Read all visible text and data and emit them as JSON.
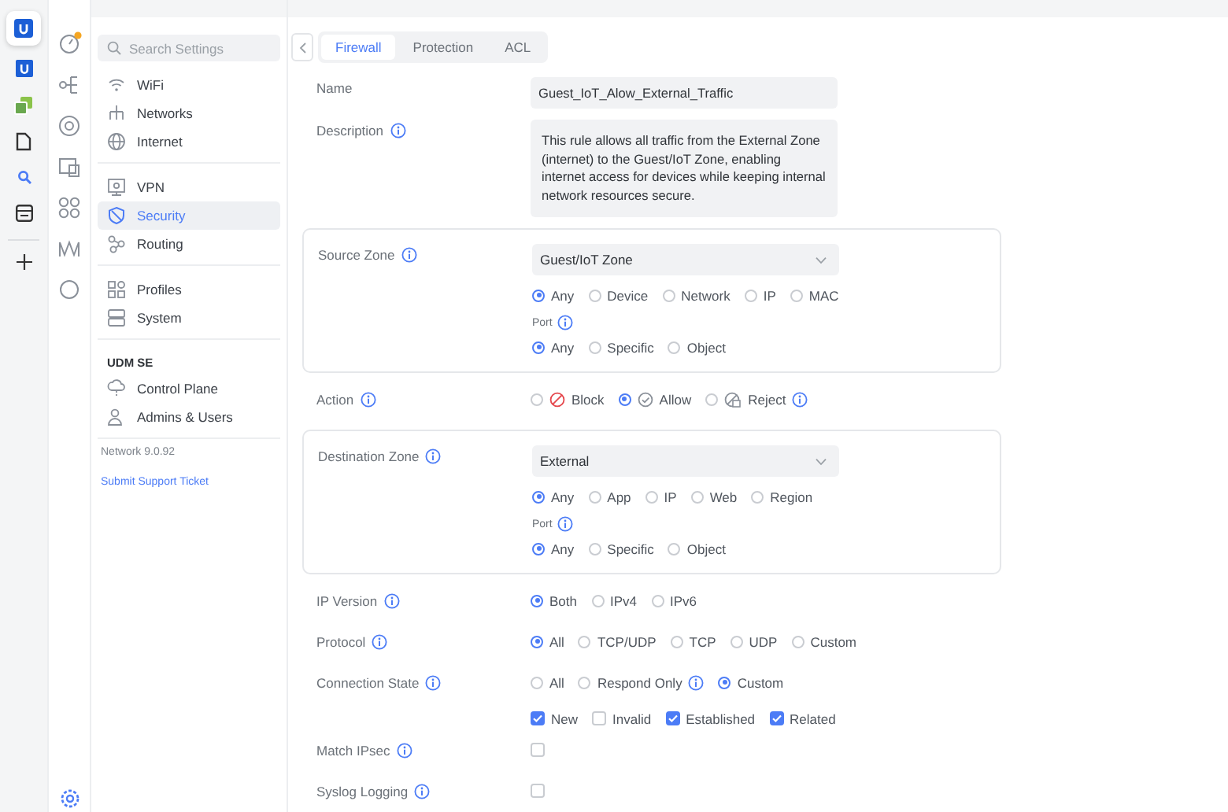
{
  "app_rail": {
    "items": [
      {
        "kind": "unifi",
        "selected": true
      },
      {
        "kind": "unifi-small",
        "selected": false
      },
      {
        "kind": "squares",
        "selected": false
      },
      {
        "kind": "document",
        "selected": false
      },
      {
        "kind": "search",
        "selected": false
      },
      {
        "kind": "panel",
        "selected": false
      }
    ]
  },
  "sidebar": {
    "search": {
      "placeholder": "Search Settings"
    },
    "groups": [
      {
        "items": [
          {
            "kind": "wifi",
            "label": "WiFi",
            "selected": false
          },
          {
            "kind": "networks",
            "label": "Networks",
            "selected": false
          },
          {
            "kind": "globe",
            "label": "Internet",
            "selected": false
          }
        ]
      },
      {
        "items": [
          {
            "kind": "vpn",
            "label": "VPN",
            "selected": false
          },
          {
            "kind": "shield",
            "label": "Security",
            "selected": true
          },
          {
            "kind": "routing",
            "label": "Routing",
            "selected": false
          }
        ]
      },
      {
        "items": [
          {
            "kind": "profiles",
            "label": "Profiles",
            "selected": false
          },
          {
            "kind": "system",
            "label": "System",
            "selected": false
          }
        ]
      },
      {
        "title": "UDM SE",
        "items": [
          {
            "kind": "cloud",
            "label": "Control Plane",
            "selected": false
          },
          {
            "kind": "users",
            "label": "Admins & Users",
            "selected": false
          }
        ]
      }
    ],
    "version": "Network 9.0.92",
    "support_link": "Submit Support Ticket"
  },
  "tabs": [
    {
      "label": "Firewall",
      "selected": true
    },
    {
      "label": "Protection",
      "selected": false
    },
    {
      "label": "ACL",
      "selected": false
    }
  ],
  "form": {
    "rows": [
      {
        "kind": "text",
        "label": "Name",
        "info": false,
        "value": "Guest_IoT_Alow_External_Traffic"
      },
      {
        "kind": "textarea",
        "label": "Description",
        "info": true,
        "value": "This rule allows all traffic from the External Zone (internet) to the Guest/IoT Zone, enabling internet access for devices while keeping internal network resources secure."
      },
      {
        "kind": "zone",
        "label": "Source Zone",
        "info": true,
        "select": "Guest/IoT Zone",
        "options": [
          {
            "label": "Any",
            "selected": true
          },
          {
            "label": "Device",
            "selected": false
          },
          {
            "label": "Network",
            "selected": false
          },
          {
            "label": "IP",
            "selected": false
          },
          {
            "label": "MAC",
            "selected": false
          }
        ],
        "port_label": "Port",
        "port_options": [
          {
            "label": "Any",
            "selected": true
          },
          {
            "label": "Specific",
            "selected": false
          },
          {
            "label": "Object",
            "selected": false
          }
        ]
      },
      {
        "kind": "radio",
        "label": "Action",
        "info": true,
        "options": [
          {
            "label": "Block",
            "kind": "block",
            "info": false,
            "selected": false
          },
          {
            "label": "Allow",
            "kind": "allow",
            "info": false,
            "selected": true
          },
          {
            "label": "Reject",
            "kind": "reject",
            "info": true,
            "selected": false
          }
        ]
      },
      {
        "kind": "zone",
        "label": "Destination Zone",
        "info": true,
        "select": "External",
        "options": [
          {
            "label": "Any",
            "selected": true
          },
          {
            "label": "App",
            "selected": false
          },
          {
            "label": "IP",
            "selected": false
          },
          {
            "label": "Web",
            "selected": false
          },
          {
            "label": "Region",
            "selected": false
          }
        ],
        "port_label": "Port",
        "port_options": [
          {
            "label": "Any",
            "selected": true
          },
          {
            "label": "Specific",
            "selected": false
          },
          {
            "label": "Object",
            "selected": false
          }
        ]
      },
      {
        "kind": "radio",
        "label": "IP Version",
        "info": true,
        "options": [
          {
            "label": "Both",
            "selected": true
          },
          {
            "label": "IPv4",
            "selected": false
          },
          {
            "label": "IPv6",
            "selected": false
          }
        ]
      },
      {
        "kind": "radio",
        "label": "Protocol",
        "info": true,
        "options": [
          {
            "label": "All",
            "selected": true
          },
          {
            "label": "TCP/UDP",
            "selected": false
          },
          {
            "label": "TCP",
            "selected": false
          },
          {
            "label": "UDP",
            "selected": false
          },
          {
            "label": "Custom",
            "selected": false
          }
        ]
      },
      {
        "kind": "radio",
        "label": "Connection State",
        "info": true,
        "options": [
          {
            "label": "All",
            "info": false,
            "selected": false
          },
          {
            "label": "Respond Only",
            "info": true,
            "selected": false
          },
          {
            "label": "Custom",
            "info": false,
            "selected": true
          }
        ],
        "checks": [
          {
            "label": "New",
            "checked": true
          },
          {
            "label": "Invalid",
            "checked": false
          },
          {
            "label": "Established",
            "checked": true
          },
          {
            "label": "Related",
            "checked": true
          }
        ]
      },
      {
        "kind": "checkbox",
        "label": "Match IPsec",
        "info": true,
        "checked": false
      },
      {
        "kind": "checkbox",
        "label": "Syslog Logging",
        "info": true,
        "checked": false
      }
    ]
  }
}
